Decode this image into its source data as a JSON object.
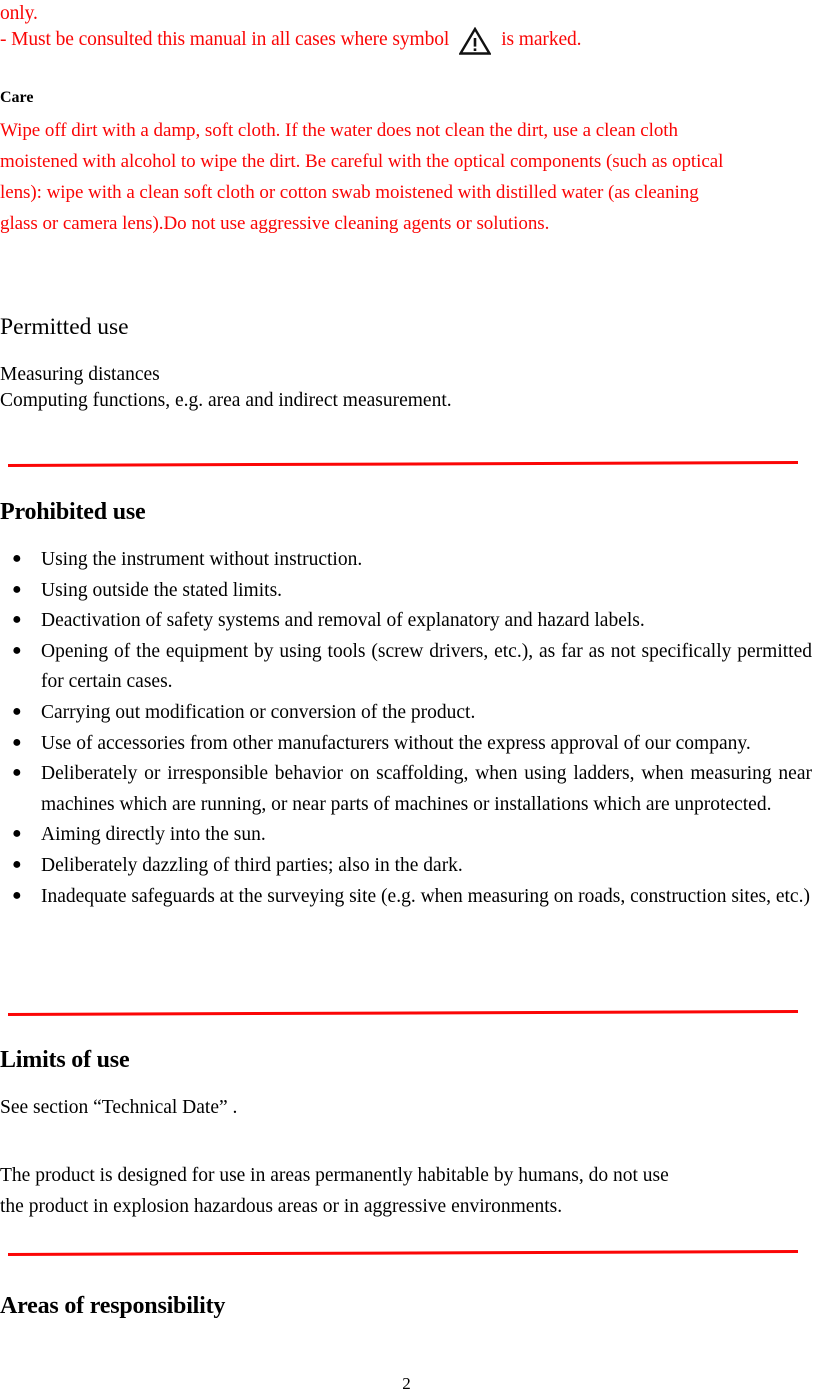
{
  "document": {
    "page_number": "2",
    "accent_red": "#fa0505",
    "text_black": "#000000"
  },
  "warning": {
    "cut_line": "only.",
    "consult_prefix": "- Must be consulted this manual in all cases where symbol",
    "symbol_icon": "warning-triangle-icon",
    "consult_suffix": "is marked."
  },
  "care": {
    "heading": "Care",
    "lines": [
      "Wipe off dirt with a damp, soft cloth. If the water does not clean the dirt, use a clean cloth",
      "moistened with alcohol to wipe the dirt. Be careful with the optical components (such as optical",
      "lens): wipe with a clean soft cloth or cotton swab moistened with distilled water (as cleaning",
      "glass or camera lens).Do not use aggressive cleaning agents or solutions."
    ]
  },
  "permitted_use": {
    "heading": "Permitted use",
    "lines": [
      "Measuring distances",
      "Computing functions, e.g. area and indirect measurement."
    ]
  },
  "prohibited_use": {
    "heading": "Prohibited use",
    "items": [
      "Using the instrument without instruction.",
      "Using outside the stated limits.",
      "Deactivation of safety systems and removal of explanatory and hazard labels.",
      "Opening of the equipment by using tools (screw drivers, etc.), as far as not specifically permitted for certain cases.",
      "Carrying out modification or conversion of the product.",
      "Use of accessories from other manufacturers without the express approval of our company.",
      "Deliberately or irresponsible behavior on scaffolding, when using ladders, when measuring near machines which are running, or near parts of machines or installations which are unprotected.",
      "Aiming directly into the sun.",
      "Deliberately dazzling of third parties; also in the dark.",
      "Inadequate safeguards at the surveying site (e.g. when measuring on roads, construction sites, etc.)"
    ],
    "item_last_line_1": "Inadequate safeguards at the surveying site (e.g. when measuring on roads,",
    "item_last_line_2": "construction sites, etc.)"
  },
  "limits_of_use": {
    "heading": "Limits of use",
    "reference": "See section “Technical Date” .",
    "body_lines": [
      "The product is designed for use in areas permanently habitable by humans, do not use",
      "the product in explosion hazardous areas or in aggressive environments."
    ]
  },
  "areas_of_responsibility": {
    "heading": "Areas of responsibility"
  }
}
